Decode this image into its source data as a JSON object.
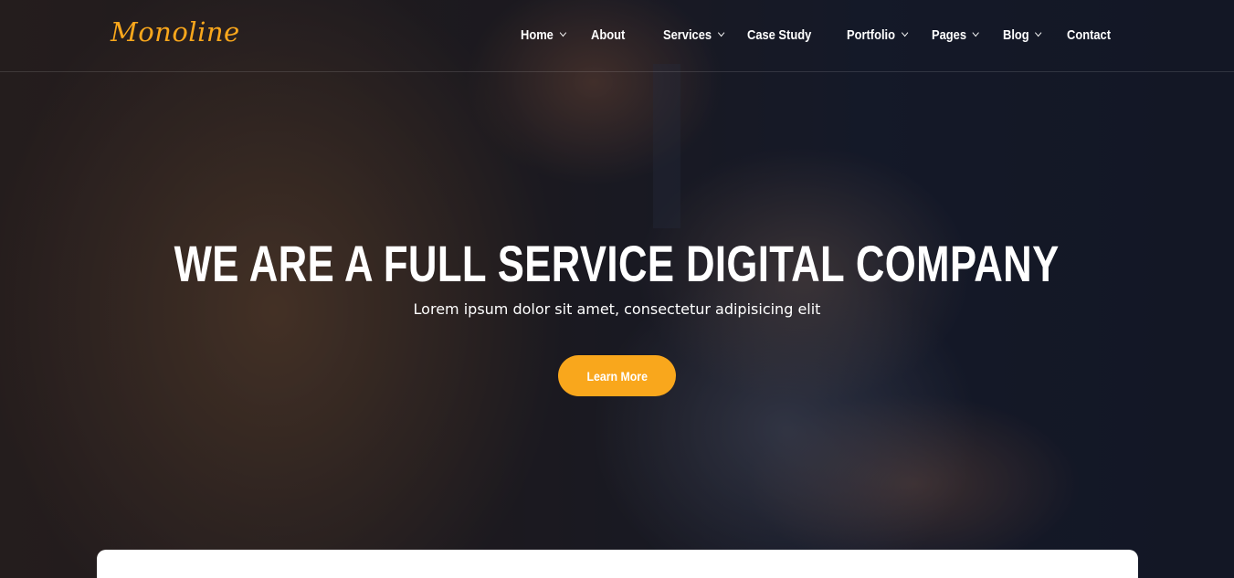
{
  "header": {
    "logo": "Monoline",
    "nav": [
      {
        "label": "Home",
        "dropdown": true
      },
      {
        "label": "About",
        "dropdown": false
      },
      {
        "label": "Services",
        "dropdown": true
      },
      {
        "label": "Case Study",
        "dropdown": false
      },
      {
        "label": "Portfolio",
        "dropdown": true
      },
      {
        "label": "Pages",
        "dropdown": true
      },
      {
        "label": "Blog",
        "dropdown": true
      },
      {
        "label": "Contact",
        "dropdown": false
      }
    ]
  },
  "hero": {
    "headline": "WE ARE A FULL SERVICE DIGITAL COMPANY",
    "subtitle": "Lorem ipsum dolor sit amet, consectetur adipisicing elit",
    "cta_label": "Learn More"
  },
  "colors": {
    "accent": "#f9a71c",
    "text": "#ffffff"
  }
}
